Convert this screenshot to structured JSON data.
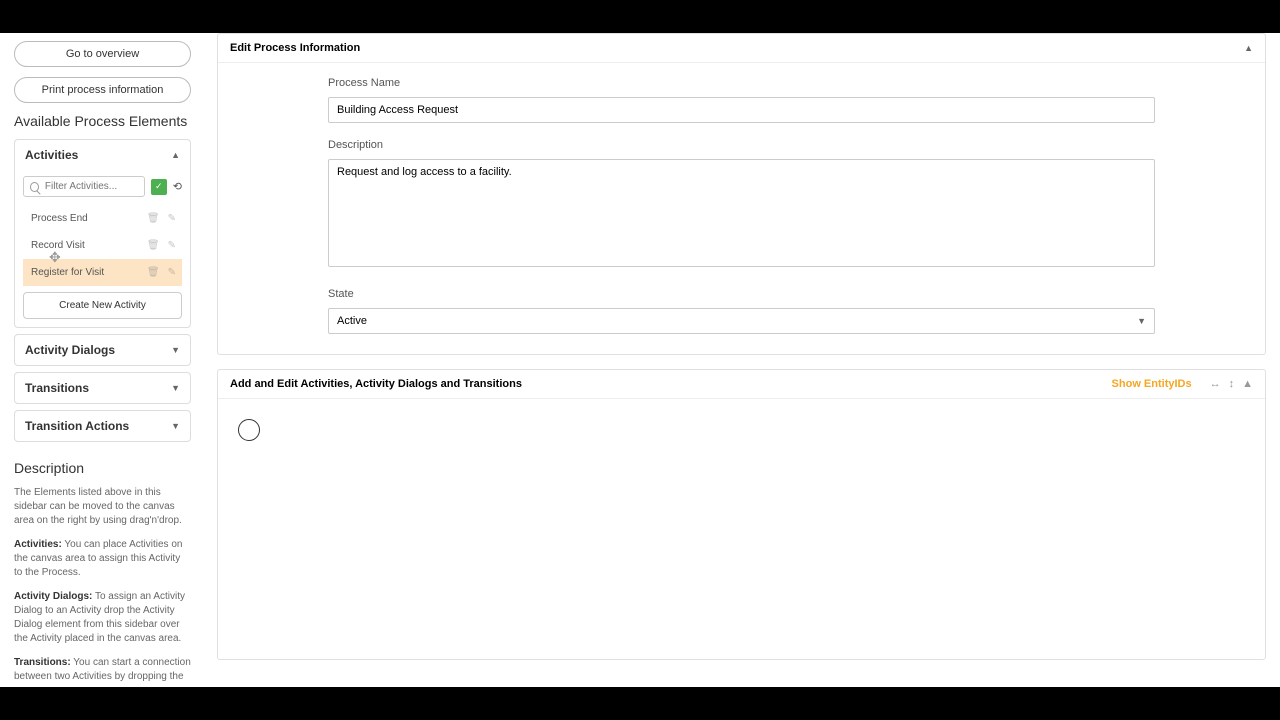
{
  "sidebar": {
    "go_overview": "Go to overview",
    "print_info": "Print process information",
    "available_title": "Available Process Elements",
    "activities": {
      "title": "Activities",
      "filter_placeholder": "Filter Activities...",
      "items": [
        {
          "name": "Process End"
        },
        {
          "name": "Record Visit"
        },
        {
          "name": "Register for Visit"
        }
      ],
      "create": "Create New Activity"
    },
    "activity_dialogs": "Activity Dialogs",
    "transitions": "Transitions",
    "transition_actions": "Transition Actions",
    "description_title": "Description",
    "desc1": "The Elements listed above in this sidebar can be moved to the canvas area on the right by using drag'n'drop.",
    "desc2_label": "Activities:",
    "desc2": " You can place Activities on the canvas area to assign this Activity to the Process.",
    "desc3_label": "Activity Dialogs:",
    "desc3": " To assign an Activity Dialog to an Activity drop the Activity Dialog element from this sidebar over the Activity placed in the canvas area.",
    "desc4_label": "Transitions:",
    "desc4": " You can start a connection between two Activities by dropping the"
  },
  "main": {
    "edit_header": "Edit Process Information",
    "process_name_label": "Process Name",
    "process_name_value": "Building Access Request",
    "description_label": "Description",
    "description_value": "Request and log access to a facility.",
    "state_label": "State",
    "state_value": "Active",
    "canvas_header": "Add and Edit Activities, Activity Dialogs and Transitions",
    "show_entity": "Show EntityIDs"
  }
}
